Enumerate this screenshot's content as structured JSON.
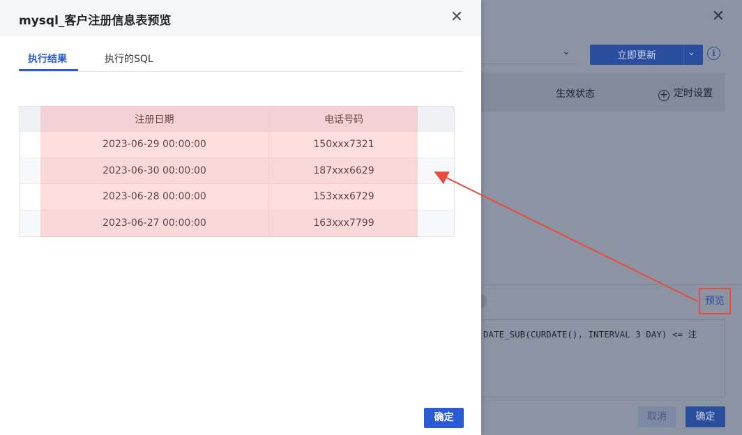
{
  "background": {
    "update_button_label": "立即更新",
    "status_column": "生效状态",
    "schedule_label": "定时设置",
    "preview_link": "预览",
    "sql_snippet": "DATE_SUB(CURDATE(), INTERVAL 3 DAY) <= 注",
    "cancel_label": "取消",
    "confirm_label": "确定"
  },
  "modal": {
    "title": "mysql_客户注册信息表预览",
    "tabs": [
      {
        "label": "执行结果",
        "active": true
      },
      {
        "label": "执行的SQL",
        "active": false
      }
    ],
    "table": {
      "headers": [
        "注册日期",
        "电话号码"
      ],
      "rows": [
        [
          "2023-06-29 00:00:00",
          "150xxx7321"
        ],
        [
          "2023-06-30 00:00:00",
          "187xxx6629"
        ],
        [
          "2023-06-28 00:00:00",
          "153xxx6729"
        ],
        [
          "2023-06-27 00:00:00",
          "163xxx7799"
        ]
      ]
    },
    "ok_label": "确定"
  },
  "colors": {
    "accent": "#2a5bd7",
    "annotation": "#e74c3c",
    "overlay": "#8c94a3"
  }
}
